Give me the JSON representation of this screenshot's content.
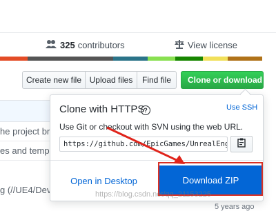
{
  "stats": {
    "contributors_count": "325",
    "contributors_label": "contributors",
    "license_label": "View license"
  },
  "language_bar": [
    "#e34c26",
    "#555555",
    "#555555",
    "#2b7489",
    "#89e051",
    "#178600",
    "#f1e05a",
    "#b07219"
  ],
  "buttons": {
    "create_file": "Create new file",
    "upload_files": "Upload files",
    "find_file": "Find file",
    "clone_download": "Clone or download"
  },
  "background": {
    "line1": "he project bro",
    "line2": "es and templa",
    "line3": "g (//UE4/Dev",
    "years": "5 years ago"
  },
  "clone_panel": {
    "title": "Clone with HTTPS",
    "help": "?",
    "use_ssh": "Use SSH",
    "description": "Use Git or checkout with SVN using the web URL.",
    "url_value": "https://github.com/EpicGames/UnrealEngin",
    "open_desktop": "Open in Desktop",
    "download_zip": "Download ZIP"
  },
  "watermark": "https://blog.csdn.net/qq_21153225",
  "colors": {
    "primary_green": "#28a745",
    "link_blue": "#0366d6",
    "highlight_red": "#d93025"
  }
}
